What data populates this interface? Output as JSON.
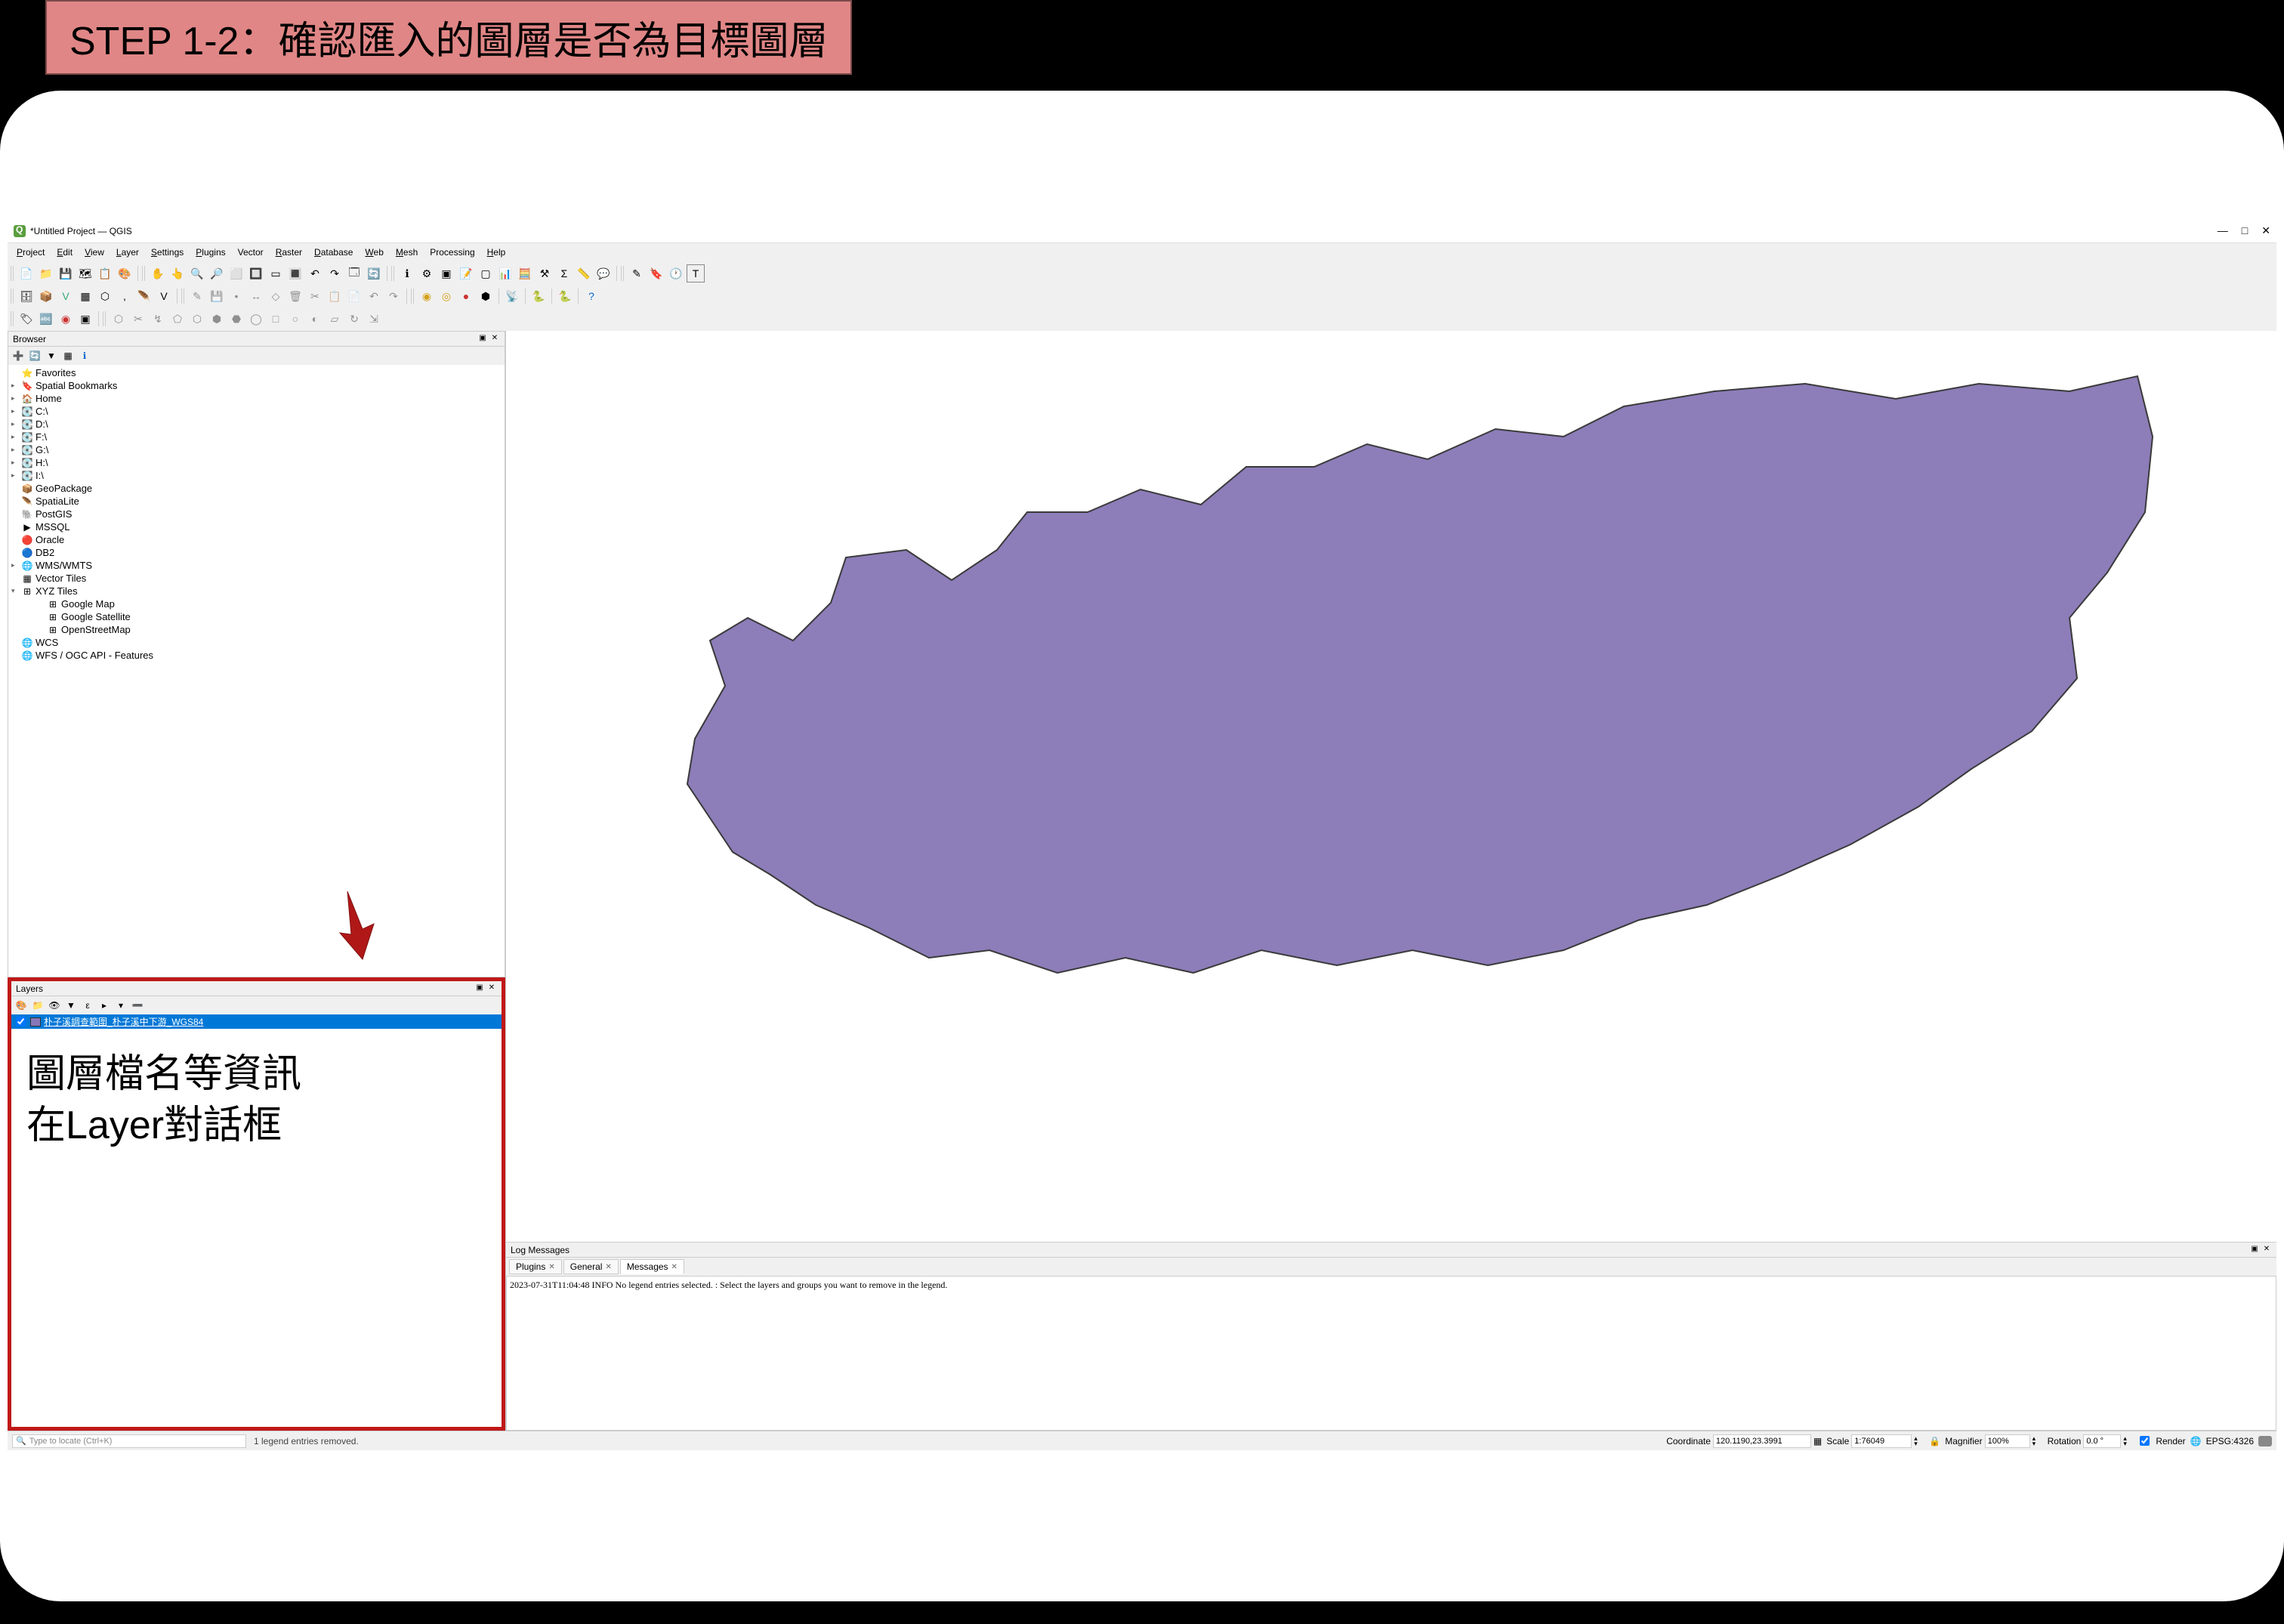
{
  "banner": "STEP 1-2：確認匯入的圖層是否為目標圖層",
  "window_title": "*Untitled Project — QGIS",
  "menus": [
    "Project",
    "Edit",
    "View",
    "Layer",
    "Settings",
    "Plugins",
    "Vector",
    "Raster",
    "Database",
    "Web",
    "Mesh",
    "Processing",
    "Help"
  ],
  "menu_underline_idx": [
    0,
    0,
    0,
    0,
    0,
    0,
    null,
    0,
    0,
    0,
    0,
    null,
    0
  ],
  "browser": {
    "title": "Browser",
    "items": [
      {
        "arrow": "",
        "icon": "star",
        "label": "Favorites",
        "cls": ""
      },
      {
        "arrow": "▸",
        "icon": "bookmark",
        "label": "Spatial Bookmarks",
        "cls": ""
      },
      {
        "arrow": "▸",
        "icon": "home",
        "label": "Home",
        "cls": ""
      },
      {
        "arrow": "▸",
        "icon": "drive",
        "label": "C:\\",
        "cls": ""
      },
      {
        "arrow": "▸",
        "icon": "drive",
        "label": "D:\\",
        "cls": ""
      },
      {
        "arrow": "▸",
        "icon": "drive",
        "label": "F:\\",
        "cls": ""
      },
      {
        "arrow": "▸",
        "icon": "drive",
        "label": "G:\\",
        "cls": ""
      },
      {
        "arrow": "▸",
        "icon": "drive",
        "label": "H:\\",
        "cls": ""
      },
      {
        "arrow": "▸",
        "icon": "drive",
        "label": "I:\\",
        "cls": ""
      },
      {
        "arrow": "",
        "icon": "geopkg",
        "label": "GeoPackage",
        "cls": ""
      },
      {
        "arrow": "",
        "icon": "feather",
        "label": "SpatiaLite",
        "cls": ""
      },
      {
        "arrow": "",
        "icon": "elephant",
        "label": "PostGIS",
        "cls": ""
      },
      {
        "arrow": "",
        "icon": "mssql",
        "label": "MSSQL",
        "cls": ""
      },
      {
        "arrow": "",
        "icon": "oracle",
        "label": "Oracle",
        "cls": ""
      },
      {
        "arrow": "",
        "icon": "db2",
        "label": "DB2",
        "cls": ""
      },
      {
        "arrow": "▸",
        "icon": "globe",
        "label": "WMS/WMTS",
        "cls": ""
      },
      {
        "arrow": "",
        "icon": "vtile",
        "label": "Vector Tiles",
        "cls": ""
      },
      {
        "arrow": "▾",
        "icon": "xyz",
        "label": "XYZ Tiles",
        "cls": ""
      },
      {
        "arrow": "",
        "icon": "grid",
        "label": "Google Map",
        "cls": "gchild"
      },
      {
        "arrow": "",
        "icon": "grid",
        "label": "Google Satellite",
        "cls": "gchild"
      },
      {
        "arrow": "",
        "icon": "grid",
        "label": "OpenStreetMap",
        "cls": "gchild"
      },
      {
        "arrow": "",
        "icon": "globe",
        "label": "WCS",
        "cls": ""
      },
      {
        "arrow": "",
        "icon": "globe",
        "label": "WFS / OGC API - Features",
        "cls": ""
      }
    ]
  },
  "layers": {
    "title": "Layers",
    "layer_name": "朴子溪調查範圍_朴子溪中下游_WGS84"
  },
  "annotation": {
    "line1": "圖層檔名等資訊",
    "line2": "在Layer對話框"
  },
  "log": {
    "title": "Log Messages",
    "tabs": [
      "Plugins",
      "General",
      "Messages"
    ],
    "active_tab": 2,
    "message": "2023-07-31T11:04:48  INFO No legend entries selected. : Select the layers and groups you want to remove in the legend."
  },
  "status": {
    "search_placeholder": "Type to locate (Ctrl+K)",
    "message": "1 legend entries removed.",
    "coord_label": "Coordinate",
    "coord_value": "120.1190,23.3991",
    "scale_label": "Scale",
    "scale_value": "1:76049",
    "magnifier_label": "Magnifier",
    "magnifier_value": "100%",
    "rotation_label": "Rotation",
    "rotation_value": "0.0 °",
    "render_label": "Render",
    "epsg": "EPSG:4326"
  },
  "shape_fill": "#8d7db9",
  "shape_stroke": "#3a3a3a"
}
